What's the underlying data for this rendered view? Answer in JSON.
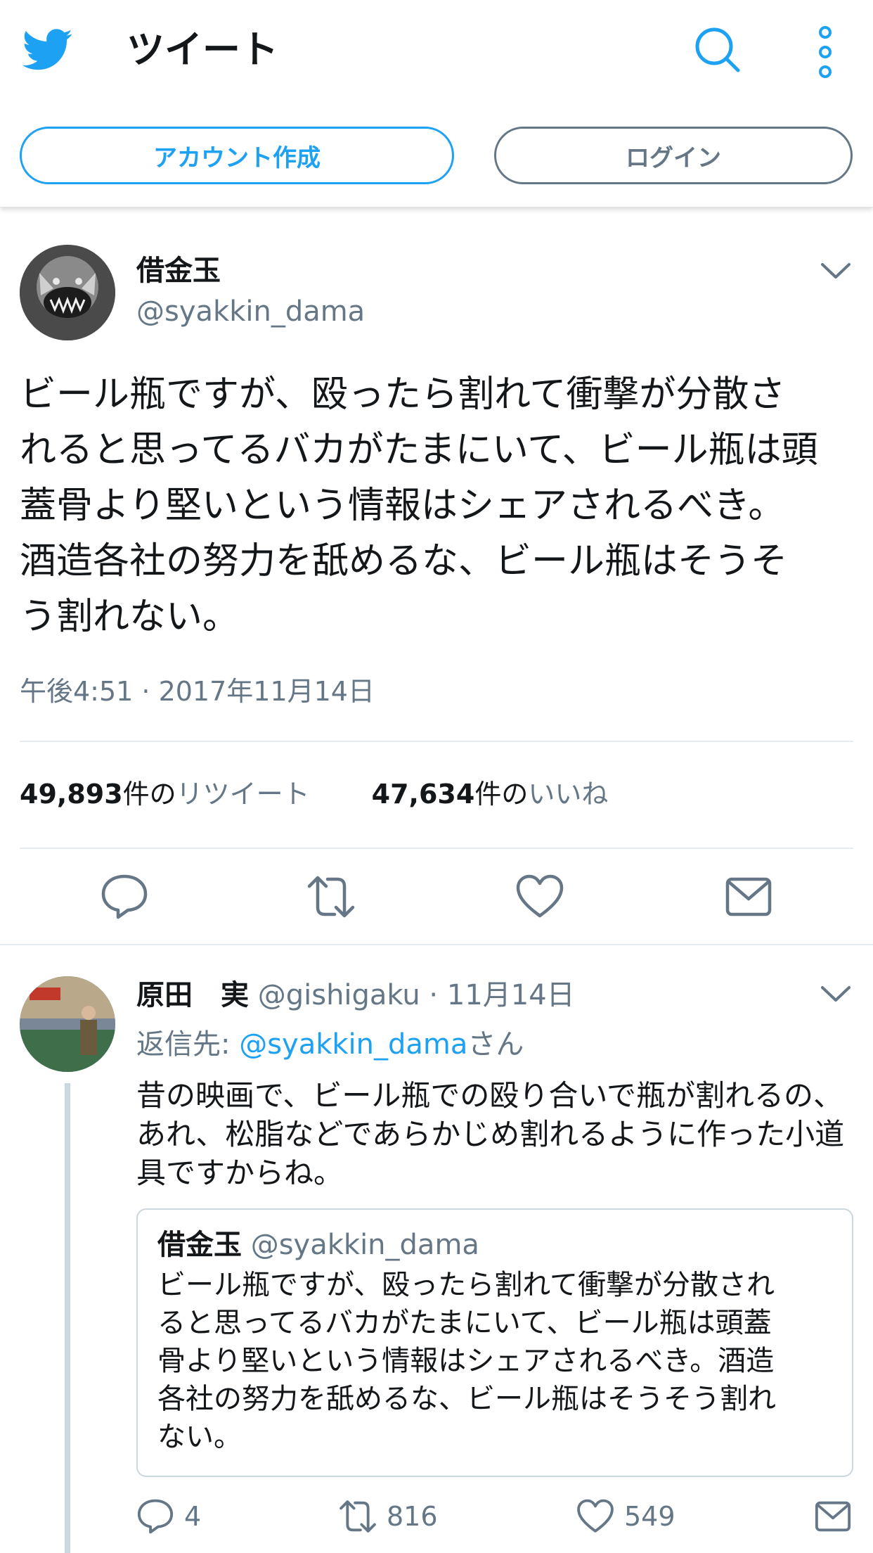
{
  "header": {
    "title": "ツイート",
    "signup_label": "アカウント作成",
    "login_label": "ログイン",
    "accent": "#1da1f2"
  },
  "tweet": {
    "author_name": "借金玉",
    "author_handle": "@syakkin_dama",
    "text": "ビール瓶ですが、殴ったら割れて衝撃が分散さ\nれると思ってるバカがたまにいて、ビール瓶は頭\n蓋骨より堅いという情報はシェアされるべき。\n酒造各社の努力を舐めるな、ビール瓶はそうそ\nう割れない。",
    "timestamp": "午後4:51 · 2017年11月14日",
    "retweet_count": "49,893",
    "retweet_unit": "件の",
    "retweet_label": "リツイート",
    "like_count": "47,634",
    "like_unit": "件の",
    "like_label": "いいね",
    "actions": [
      "reply-icon",
      "retweet-icon",
      "like-icon",
      "share-icon"
    ]
  },
  "reply": {
    "author_name": "原田　実",
    "author_handle": "@gishigaku",
    "date": " · 11月14日",
    "reply_to_prefix": "返信先: ",
    "reply_to_handle": "@syakkin_dama",
    "reply_to_suffix": "さん",
    "text": "昔の映画で、ビール瓶での殴り合いで瓶が割れるの、\nあれ、松脂などであらかじめ割れるように作った小道\n具ですからね。",
    "quote": {
      "author_name": "借金玉",
      "author_handle": "@syakkin_dama",
      "text": "ビール瓶ですが、殴ったら割れて衝撃が分散され\nると思ってるバカがたまにいて、ビール瓶は頭蓋\n骨より堅いという情報はシェアされるべき。酒造\n各社の努力を舐めるな、ビール瓶はそうそう割れ\nない。"
    },
    "reply_count": "4",
    "retweet_count": "816",
    "like_count": "549"
  }
}
